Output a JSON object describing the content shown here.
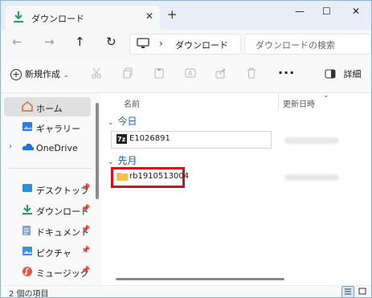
{
  "window": {
    "tab_title": "ダウンロード",
    "close_tab": "✕",
    "new_tab": "+",
    "minimize": "—",
    "maximize": "☐",
    "close": "✕"
  },
  "address": {
    "back": "←",
    "forward": "→",
    "up": "↑",
    "refresh": "↻",
    "separator": "›",
    "breadcrumb": "ダウンロード",
    "search_placeholder": "ダウンロードの検索"
  },
  "commandbar": {
    "new_label": "新規作成",
    "new_chevron": "⌄",
    "more": "···",
    "details_label": "詳細"
  },
  "sidebar": {
    "items": [
      {
        "label": "ホーム",
        "icon": "home-icon"
      },
      {
        "label": "ギャラリー",
        "icon": "gallery-icon"
      },
      {
        "label": "OneDrive",
        "icon": "cloud-icon",
        "chevron": "›"
      },
      {
        "label": "デスクトップ",
        "icon": "desktop-icon",
        "pin": "📌"
      },
      {
        "label": "ダウンロード",
        "icon": "download-icon",
        "pin": "📌"
      },
      {
        "label": "ドキュメント",
        "icon": "document-icon",
        "pin": "📌"
      },
      {
        "label": "ピクチャ",
        "icon": "picture-icon",
        "pin": "📌"
      },
      {
        "label": "ミュージック",
        "icon": "music-icon",
        "pin": "📌"
      }
    ]
  },
  "content": {
    "col_name": "名前",
    "col_date": "更新日時",
    "groups": [
      {
        "label": "今日",
        "chevron": "⌄",
        "files": [
          {
            "name": "E1026891",
            "icon": "7z-archive-icon"
          }
        ]
      },
      {
        "label": "先月",
        "chevron": "⌄",
        "files": [
          {
            "name": "rb1910513004",
            "icon": "folder-icon"
          }
        ]
      }
    ]
  },
  "status": {
    "count": "2 個の項目"
  },
  "colors": {
    "accent": "#1f5ea8",
    "highlight_border": "#d0121b",
    "folder": "#f2c14e",
    "download_green": "#1e9e6a"
  }
}
